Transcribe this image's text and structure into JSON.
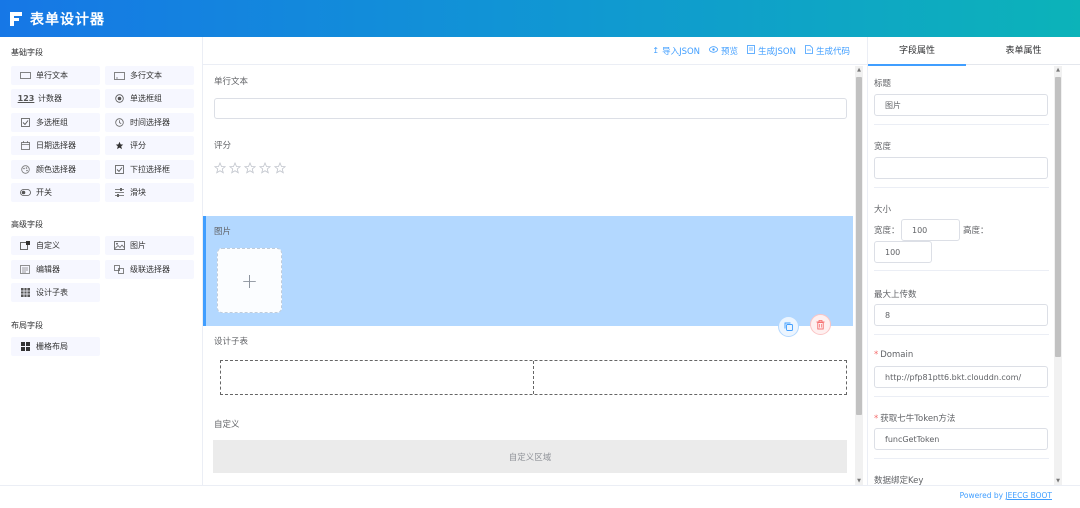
{
  "app": {
    "title": "表单设计器"
  },
  "colors": {
    "accent": "#409eff",
    "header_start": "#1677e6",
    "header_end": "#0cb3b9",
    "selected_bg": "#b3d8ff",
    "delete": "#f56c6c"
  },
  "sidebar": {
    "basic_title": "基础字段",
    "basic": [
      {
        "label": "单行文本",
        "icon": "input-icon"
      },
      {
        "label": "多行文本",
        "icon": "textarea-icon"
      },
      {
        "label": "计数器",
        "icon": "number-icon"
      },
      {
        "label": "单选框组",
        "icon": "radio-icon"
      },
      {
        "label": "多选框组",
        "icon": "checkbox-icon"
      },
      {
        "label": "时间选择器",
        "icon": "clock-icon"
      },
      {
        "label": "日期选择器",
        "icon": "calendar-icon"
      },
      {
        "label": "评分",
        "icon": "star-icon"
      },
      {
        "label": "颜色选择器",
        "icon": "color-icon"
      },
      {
        "label": "下拉选择框",
        "icon": "select-icon"
      },
      {
        "label": "开关",
        "icon": "switch-icon"
      },
      {
        "label": "滑块",
        "icon": "slider-icon"
      }
    ],
    "advanced_title": "高级字段",
    "advanced": [
      {
        "label": "自定义",
        "icon": "custom-icon"
      },
      {
        "label": "图片",
        "icon": "image-icon"
      },
      {
        "label": "编辑器",
        "icon": "editor-icon"
      },
      {
        "label": "级联选择器",
        "icon": "cascader-icon"
      },
      {
        "label": "设计子表",
        "icon": "table-icon"
      }
    ],
    "layout_title": "布局字段",
    "layout": [
      {
        "label": "栅格布局",
        "icon": "grid-icon"
      }
    ]
  },
  "toolbar": {
    "import_json": "导入JSON",
    "preview": "预览",
    "generate_json": "生成JSON",
    "generate_code": "生成代码"
  },
  "canvas": {
    "field_text": "单行文本",
    "field_rate": "评分",
    "rate_max": 5,
    "rate_value": 0,
    "field_image": "图片",
    "field_subtable": "设计子表",
    "field_custom": "自定义",
    "custom_area": "自定义区域"
  },
  "props": {
    "tab_field": "字段属性",
    "tab_form": "表单属性",
    "title_label": "标题",
    "title_value": "图片",
    "width_label": "宽度",
    "width_value": "",
    "size_label": "大小",
    "size_width_label": "宽度：",
    "size_width_value": "100",
    "size_height_label": "高度：",
    "size_height_value": "100",
    "max_upload_label": "最大上传数",
    "max_upload_value": "8",
    "domain_label": "Domain",
    "domain_value": "http://pfp81ptt6.bkt.clouddn.com/",
    "token_label": "获取七牛Token方法",
    "token_value": "funcGetToken",
    "key_label": "数据绑定Key",
    "required_mark": "*"
  },
  "footer": {
    "powered_by": "Powered by",
    "brand": "JEECG BOOT"
  }
}
